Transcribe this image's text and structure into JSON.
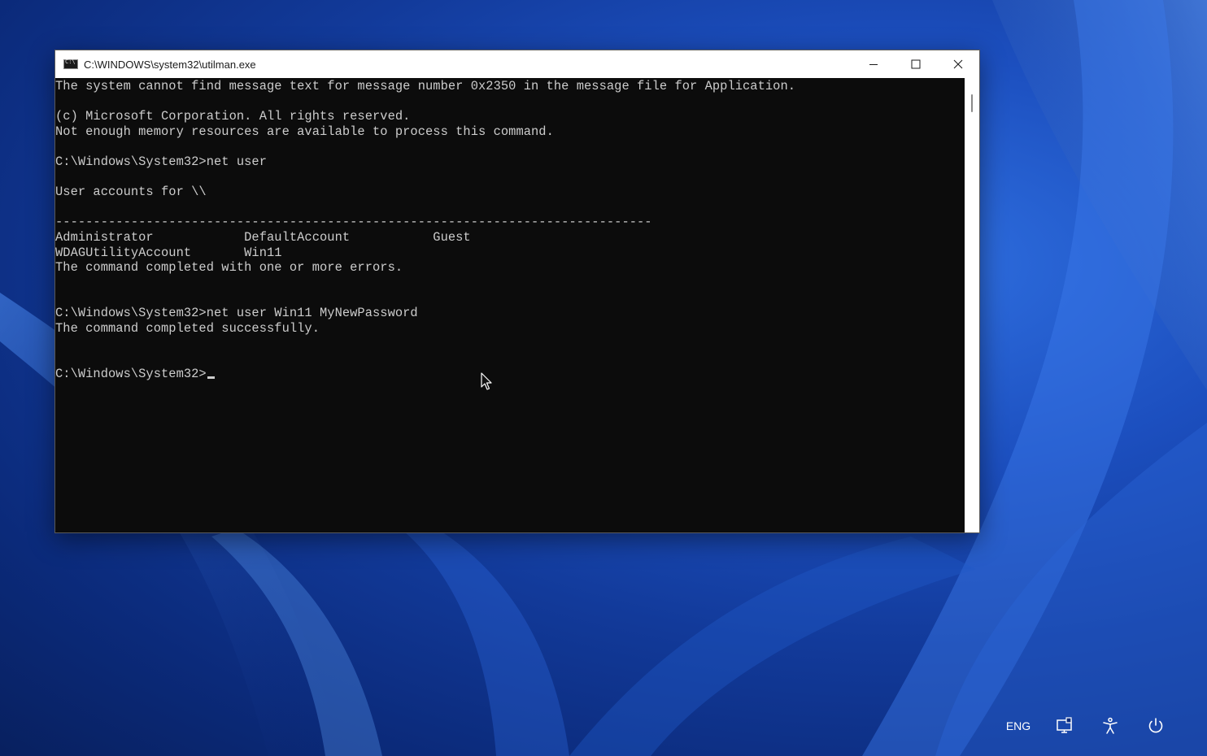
{
  "window": {
    "title": "C:\\WINDOWS\\system32\\utilman.exe"
  },
  "console": {
    "lines": [
      "The system cannot find message text for message number 0x2350 in the message file for Application.",
      "",
      "(c) Microsoft Corporation. All rights reserved.",
      "Not enough memory resources are available to process this command.",
      "",
      "C:\\Windows\\System32>net user",
      "",
      "User accounts for \\\\",
      "",
      "-------------------------------------------------------------------------------",
      "Administrator            DefaultAccount           Guest",
      "WDAGUtilityAccount       Win11",
      "The command completed with one or more errors.",
      "",
      "",
      "C:\\Windows\\System32>net user Win11 MyNewPassword",
      "The command completed successfully.",
      "",
      "",
      "C:\\Windows\\System32>"
    ]
  },
  "tray": {
    "language": "ENG",
    "icons": [
      "network-icon",
      "accessibility-icon",
      "power-icon"
    ]
  }
}
